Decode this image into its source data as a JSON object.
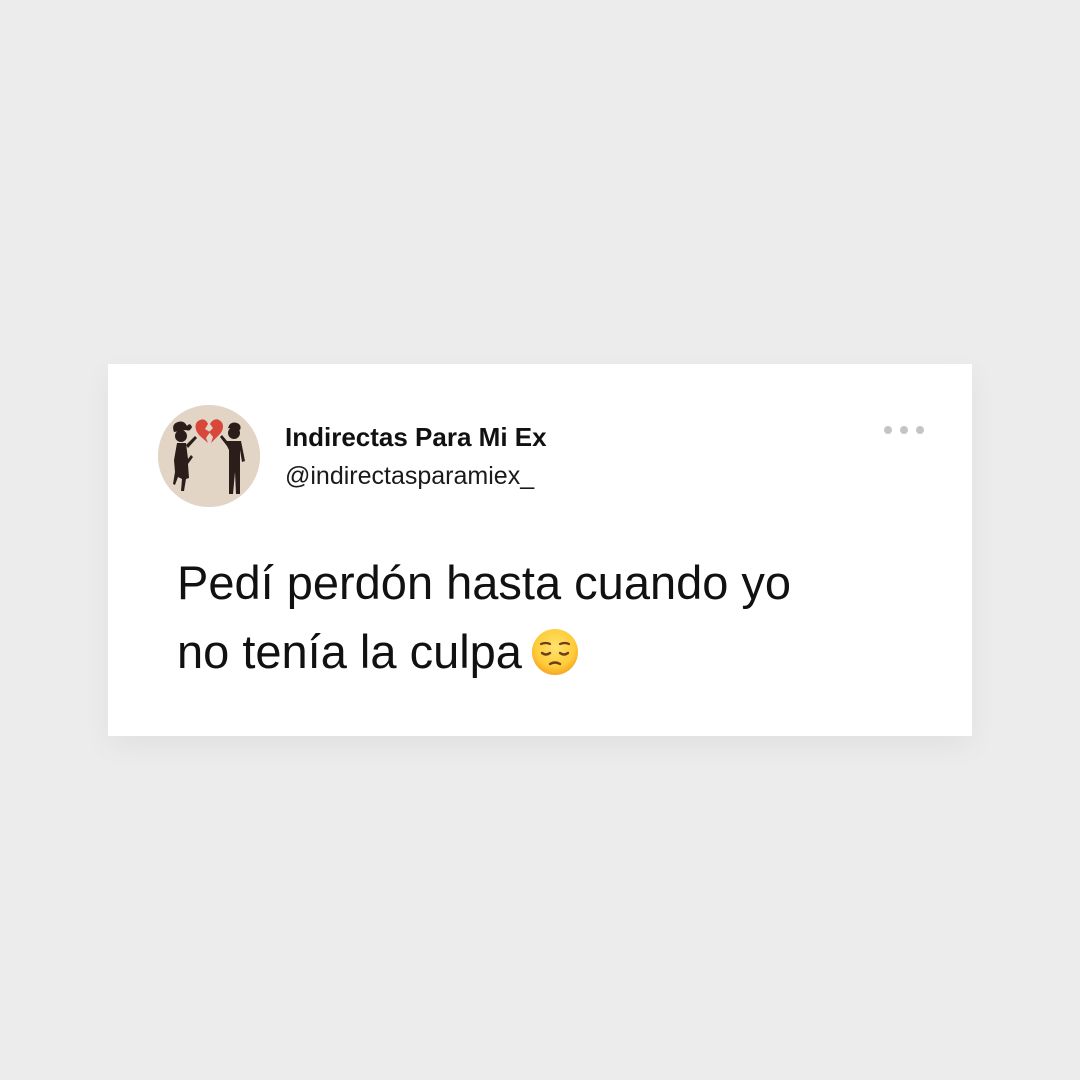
{
  "tweet": {
    "account_name": "Indirectas Para Mi Ex",
    "handle": "@indirectasparamiex_",
    "text_line_1": "Pedí perdón hasta cuando yo",
    "text_line_2": "no tenía la culpa",
    "emoji": "pensive-face-emoji",
    "avatar_icon": "broken-heart-couple-icon",
    "more_icon": "more-options-icon"
  },
  "colors": {
    "background": "#ececec",
    "card": "#ffffff",
    "text": "#111111",
    "more_dots": "#c4c4c4",
    "avatar_bg": "#e2d5c6",
    "heart": "#d9473a",
    "silhouette": "#2b1d1a"
  }
}
